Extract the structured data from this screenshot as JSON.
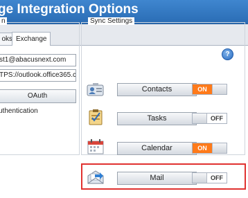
{
  "window": {
    "title": "ge Integration Options"
  },
  "tabs": [
    {
      "label": "oks",
      "active": false
    },
    {
      "label": "Exchange",
      "active": true
    }
  ],
  "left_panel": {
    "group_label": "n",
    "email_value": "st1@abacusnext.com",
    "url_value": "TPS://outlook.office365.c",
    "oauth_label": "OAuth",
    "auth_text": "uthentication"
  },
  "sync_settings": {
    "label": "Sync Settings",
    "items": [
      {
        "label": "Contacts",
        "toggle": "ON",
        "state": "on",
        "icon": "contacts-icon"
      },
      {
        "label": "Tasks",
        "toggle": "OFF",
        "state": "off",
        "icon": "tasks-icon"
      },
      {
        "label": "Calendar",
        "toggle": "ON",
        "state": "on",
        "icon": "calendar-icon"
      },
      {
        "label": "Mail",
        "toggle": "OFF",
        "state": "off",
        "icon": "mail-icon",
        "highlighted": true
      }
    ]
  },
  "help": {
    "glyph": "?"
  },
  "colors": {
    "title_bar": "#2f76c1",
    "toggle_on": "#ff7a1a",
    "highlight": "#e0312f"
  }
}
